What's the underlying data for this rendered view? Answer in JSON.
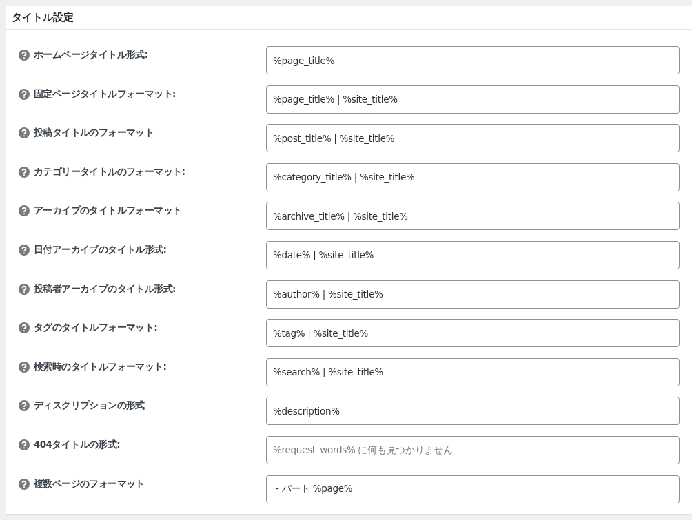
{
  "panel": {
    "title": "タイトル設定"
  },
  "settings": [
    {
      "label": "ホームページタイトル形式:",
      "value": "%page_title%"
    },
    {
      "label": "固定ページタイトルフォーマット:",
      "value": "%page_title% | %site_title%"
    },
    {
      "label": "投稿タイトルのフォーマット",
      "value": "%post_title% | %site_title%"
    },
    {
      "label": "カテゴリータイトルのフォーマット:",
      "value": "%category_title% | %site_title%"
    },
    {
      "label": "アーカイブのタイトルフォーマット",
      "value": "%archive_title% | %site_title%"
    },
    {
      "label": "日付アーカイブのタイトル形式:",
      "value": "%date% | %site_title%"
    },
    {
      "label": "投稿者アーカイブのタイトル形式:",
      "value": "%author% | %site_title%"
    },
    {
      "label": "タグのタイトルフォーマット:",
      "value": "%tag% | %site_title%"
    },
    {
      "label": "検索時のタイトルフォーマット:",
      "value": "%search% | %site_title%"
    },
    {
      "label": "ディスクリプションの形式",
      "value": "%description%"
    },
    {
      "label": "404タイトルの形式:",
      "placeholder": "%request_words% に何も見つかりません"
    },
    {
      "label": "複数ページのフォーマット",
      "value": " - パート %page%"
    }
  ]
}
